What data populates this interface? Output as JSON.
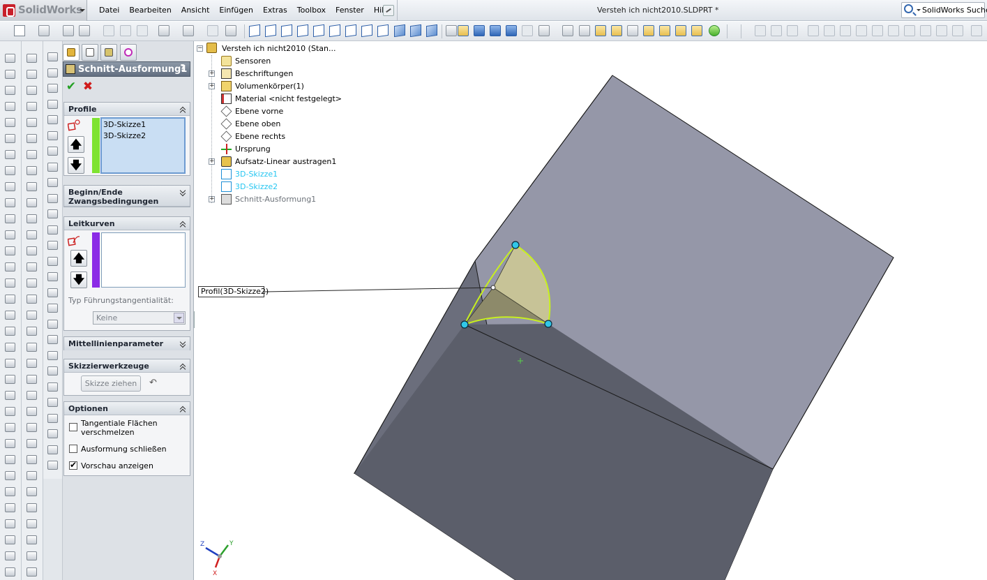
{
  "app": {
    "brand": "SolidWorks",
    "document_title": "Versteh ich nicht2010.SLDPRT *"
  },
  "menu": [
    "Datei",
    "Bearbeiten",
    "Ansicht",
    "Einfügen",
    "Extras",
    "Toolbox",
    "Fenster",
    "Hilfe"
  ],
  "search": {
    "label": "SolidWorks Suche"
  },
  "property_manager": {
    "title": "Schnitt-Ausformung1",
    "help": "?",
    "groups": {
      "profile": {
        "title": "Profile",
        "items": [
          "3D-Skizze1",
          "3D-Skizze2"
        ],
        "color": "#7ee331"
      },
      "constraints": {
        "title": "Beginn/Ende Zwangsbedingungen"
      },
      "guides": {
        "title": "Leitkurven",
        "color": "#8b2be6",
        "tangency_label": "Typ Führungstangentialität:",
        "tangency_value": "Keine"
      },
      "centerline": {
        "title": "Mittellinienparameter"
      },
      "sketch_tools": {
        "title": "Skizzierwerkzeuge",
        "drag_label": "Skizze ziehen"
      },
      "options": {
        "title": "Optionen",
        "merge_tangent": {
          "label": "Tangentiale Flächen verschmelzen",
          "checked": false
        },
        "close_loft": {
          "label": "Ausformung schließen",
          "checked": false
        },
        "show_preview": {
          "label": "Vorschau anzeigen",
          "checked": true
        }
      }
    }
  },
  "feature_tree": {
    "root": "Versteh ich nicht2010  (Stan...",
    "items": [
      {
        "label": "Sensoren",
        "expander": false,
        "style": "normal"
      },
      {
        "label": "Beschriftungen",
        "expander": true,
        "style": "normal"
      },
      {
        "label": "Volumenkörper(1)",
        "expander": true,
        "style": "normal"
      },
      {
        "label": "Material <nicht festgelegt>",
        "expander": false,
        "style": "normal"
      },
      {
        "label": "Ebene vorne",
        "expander": false,
        "style": "normal"
      },
      {
        "label": "Ebene oben",
        "expander": false,
        "style": "normal"
      },
      {
        "label": "Ebene rechts",
        "expander": false,
        "style": "normal"
      },
      {
        "label": "Ursprung",
        "expander": false,
        "style": "normal"
      },
      {
        "label": "Aufsatz-Linear austragen1",
        "expander": true,
        "style": "normal"
      },
      {
        "label": "3D-Skizze1",
        "expander": false,
        "style": "sketch"
      },
      {
        "label": "3D-Skizze2",
        "expander": false,
        "style": "sketch"
      },
      {
        "label": "Schnitt-Ausformung1",
        "expander": true,
        "style": "muted"
      }
    ]
  },
  "viewport": {
    "callout": "Profil(3D-Skizze2)",
    "triad_labels": {
      "x": "X",
      "y": "Y",
      "z": "Z"
    },
    "colors": {
      "cube_top": "#9597a8",
      "cube_front": "#5b5e6a",
      "cube_side": "#6b6e7c",
      "loft_fill": "#d3cf9a",
      "highlight": "#c8f01e",
      "point": "#31c7e8"
    }
  }
}
